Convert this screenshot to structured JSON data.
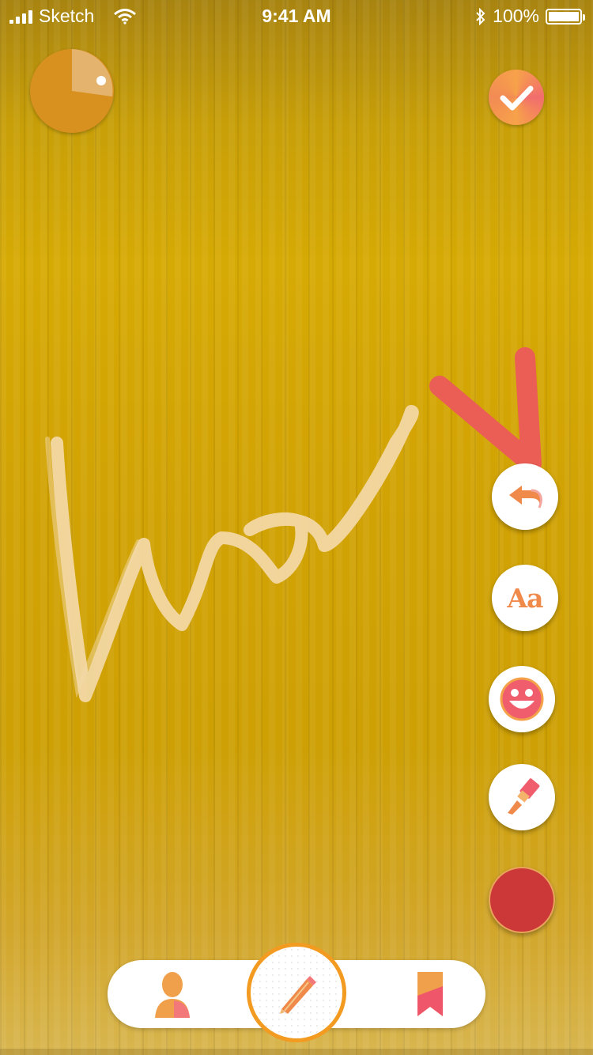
{
  "status_bar": {
    "carrier": "Sketch",
    "time": "9:41 AM",
    "battery": "100%"
  },
  "drawing": {
    "handwritten_text": "love",
    "stroke_color": "#f3d9a8"
  },
  "tools": {
    "undo": {
      "icon": "undo-arrow-icon"
    },
    "text": {
      "label": "Aa",
      "icon": "text-tool-icon"
    },
    "sticker": {
      "icon": "smiley-sticker-icon"
    },
    "brush": {
      "icon": "paintbrush-icon"
    },
    "color": {
      "value": "#cc3838"
    }
  },
  "top": {
    "timer_icon": "timer-pie-icon",
    "confirm_icon": "checkmark-icon"
  },
  "bottom_nav": {
    "items": [
      {
        "icon": "profile-icon"
      },
      {
        "icon": "pencil-icon",
        "active": true
      },
      {
        "icon": "bookmark-icon"
      }
    ]
  },
  "colors": {
    "accent_orange": "#f39a21",
    "brand_coral": "#f07a4a",
    "annotation_red": "#ea5e55"
  }
}
